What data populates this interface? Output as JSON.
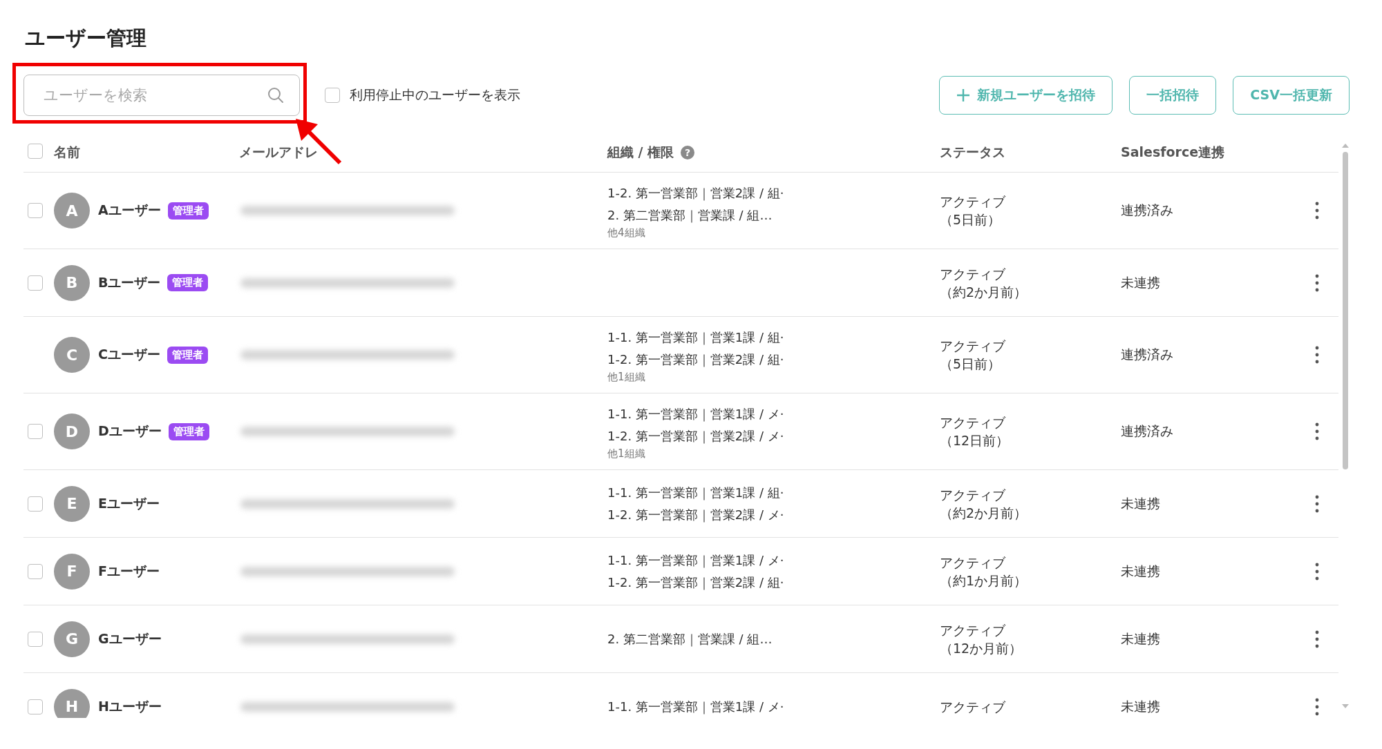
{
  "page_title": "ユーザー管理",
  "search": {
    "placeholder": "ユーザーを検索",
    "highlighted": true
  },
  "show_suspended": {
    "label": "利用停止中のユーザーを表示",
    "checked": false
  },
  "buttons": [
    {
      "label": "新規ユーザーを招待",
      "kind": "add"
    },
    {
      "label": "一括招待",
      "kind": "plain"
    },
    {
      "label": "CSV一括更新",
      "kind": "plain"
    }
  ],
  "table": {
    "select_all_checked": false,
    "columns": [
      {
        "label": "名前"
      },
      {
        "label": "メールアドレ"
      },
      {
        "label": "組織 / 権限",
        "help": "?"
      },
      {
        "label": "ステータス"
      },
      {
        "label": "Salesforce連携"
      }
    ],
    "rows": [
      {
        "has_checkbox": true,
        "checked": false,
        "initial": "A",
        "name": "Aユーザー",
        "badge": "管理者",
        "org_lines": [
          "1-2. 第一営業部｜営業2課 / 組·",
          "2. 第二営業部｜営業課 / 組…"
        ],
        "org_more": "他4組織",
        "status": "アクティブ",
        "status_detail": "（5日前）",
        "salesforce": "連携済み"
      },
      {
        "has_checkbox": true,
        "checked": false,
        "initial": "B",
        "name": "Bユーザー",
        "badge": "管理者",
        "status": "アクティブ",
        "status_detail": "（約2か月前）",
        "salesforce": "未連携"
      },
      {
        "has_checkbox": false,
        "initial": "C",
        "name": "Cユーザー",
        "badge": "管理者",
        "org_lines": [
          "1-1. 第一営業部｜営業1課 / 組·",
          "1-2. 第一営業部｜営業2課 / 組·"
        ],
        "org_more": "他1組織",
        "status": "アクティブ",
        "status_detail": "（5日前）",
        "salesforce": "連携済み"
      },
      {
        "has_checkbox": true,
        "checked": false,
        "initial": "D",
        "name": "Dユーザー",
        "badge": "管理者",
        "org_lines": [
          "1-1. 第一営業部｜営業1課 / メ·",
          "1-2. 第一営業部｜営業2課 / メ·"
        ],
        "org_more": "他1組織",
        "status": "アクティブ",
        "status_detail": "（12日前）",
        "salesforce": "連携済み"
      },
      {
        "has_checkbox": true,
        "checked": false,
        "initial": "E",
        "name": "Eユーザー",
        "org_lines": [
          "1-1. 第一営業部｜営業1課 / 組·",
          "1-2. 第一営業部｜営業2課 / メ·"
        ],
        "status": "アクティブ",
        "status_detail": "（約2か月前）",
        "salesforce": "未連携"
      },
      {
        "has_checkbox": true,
        "checked": false,
        "initial": "F",
        "name": "Fユーザー",
        "org_lines": [
          "1-1. 第一営業部｜営業1課 / メ·",
          "1-2. 第一営業部｜営業2課 / 組·"
        ],
        "status": "アクティブ",
        "status_detail": "（約1か月前）",
        "salesforce": "未連携"
      },
      {
        "has_checkbox": true,
        "checked": false,
        "initial": "G",
        "name": "Gユーザー",
        "org_lines": [
          "2. 第二営業部｜営業課 / 組…"
        ],
        "status": "アクティブ",
        "status_detail": "（12か月前）",
        "salesforce": "未連携"
      },
      {
        "has_checkbox": true,
        "checked": false,
        "initial": "H",
        "name": "Hユーザー",
        "org_lines": [
          "1-1. 第一営業部｜営業1課 / メ·"
        ],
        "status": "アクティブ",
        "salesforce": "未連携"
      }
    ]
  }
}
